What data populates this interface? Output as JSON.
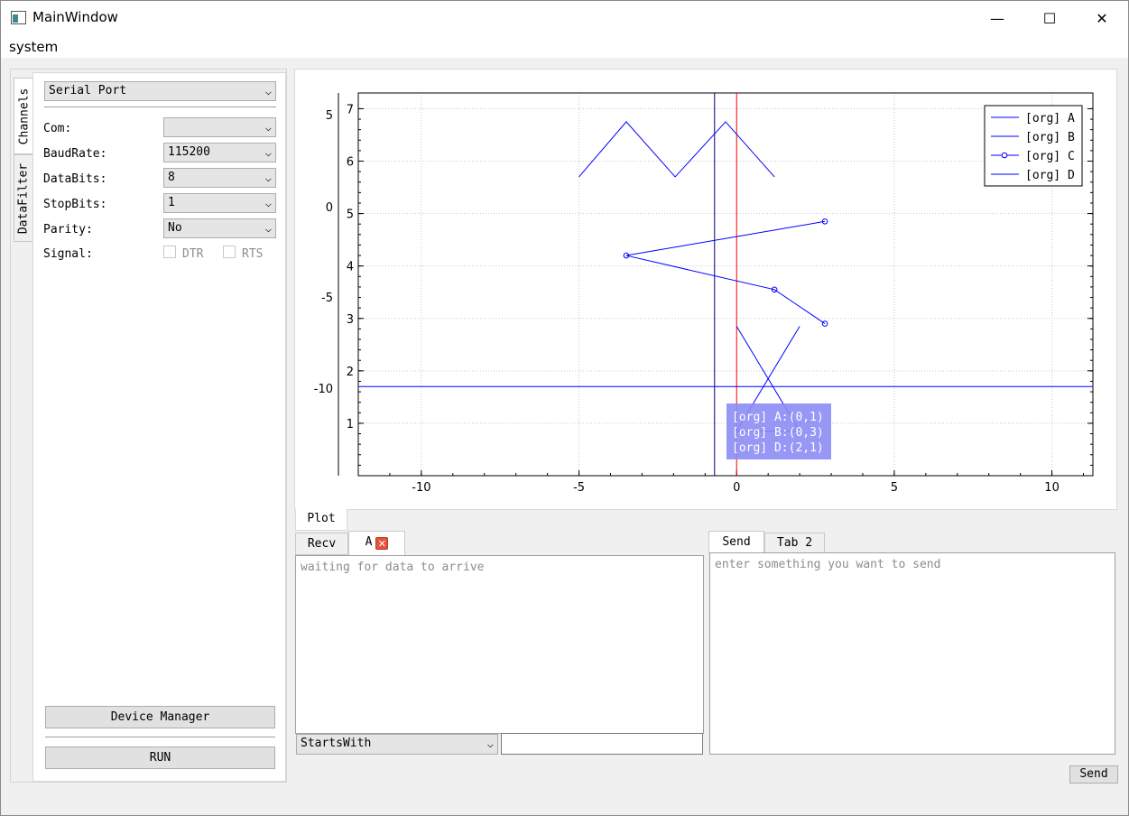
{
  "window": {
    "title": "MainWindow",
    "minimize": "—",
    "maximize": "☐",
    "close": "✕"
  },
  "menu": {
    "system": "system"
  },
  "dock": {
    "tabs": [
      "Channels",
      "DataFilter"
    ],
    "port_type": "Serial Port",
    "fields": {
      "com_label": "Com:",
      "com_value": "",
      "baud_label": "BaudRate:",
      "baud_value": "115200",
      "databits_label": "DataBits:",
      "databits_value": "8",
      "stopbits_label": "StopBits:",
      "stopbits_value": "1",
      "parity_label": "Parity:",
      "parity_value": "No",
      "signal_label": "Signal:",
      "dtr_label": "DTR",
      "rts_label": "RTS"
    },
    "device_manager": "Device Manager",
    "run": "RUN"
  },
  "plot": {
    "tab_label": "Plot",
    "legend": [
      "[org] A",
      "[org] B",
      "[org] C",
      "[org] D"
    ],
    "tooltip": [
      "[org] A:(0,1)",
      "[org] B:(0,3)",
      "[org] D:(2,1)"
    ],
    "colors": {
      "series": "#0000ff",
      "cursor_red": "#ff0000",
      "cursor_dark": "#000080",
      "tooltip_bg": "#8c8cf5"
    }
  },
  "chart_data": {
    "type": "line",
    "xlim": [
      -12,
      11.3
    ],
    "ylim_right": [
      0,
      7.3
    ],
    "x_ticks": [
      -10,
      -5,
      0,
      5,
      10
    ],
    "y_ticks_right": [
      1,
      2,
      3,
      4,
      5,
      6,
      7
    ],
    "y_ticks_left": [
      5,
      0,
      -5,
      -10
    ],
    "grid": true,
    "legend_position": "top-right",
    "series": [
      {
        "name": "[org] A",
        "points": [
          [
            -5,
            5.7
          ],
          [
            -3.5,
            6.75
          ],
          [
            -1.95,
            5.7
          ],
          [
            -0.35,
            6.75
          ],
          [
            1.2,
            5.7
          ]
        ]
      },
      {
        "name": "[org] B",
        "points": [
          [
            2.8,
            4.85
          ],
          [
            -3.5,
            4.2
          ],
          [
            1.2,
            3.55
          ],
          [
            2.8,
            2.9
          ]
        ],
        "markers": true
      },
      {
        "name": "[org] C",
        "points": [
          [
            0,
            2.85
          ],
          [
            2,
            0.85
          ],
          [
            0,
            0.85
          ],
          [
            2,
            2.85
          ]
        ]
      },
      {
        "name": "[org] D",
        "points": [
          [
            -12,
            1.7
          ],
          [
            11.3,
            1.7
          ]
        ]
      }
    ],
    "cursor_x": [
      -0.7,
      0
    ]
  },
  "recv": {
    "tabs": [
      "Recv",
      "A"
    ],
    "placeholder": "waiting for data to arrive",
    "filter_mode": "StartsWith"
  },
  "send": {
    "tabs": [
      "Send",
      "Tab 2"
    ],
    "placeholder": "enter something you want to send",
    "button": "Send"
  }
}
